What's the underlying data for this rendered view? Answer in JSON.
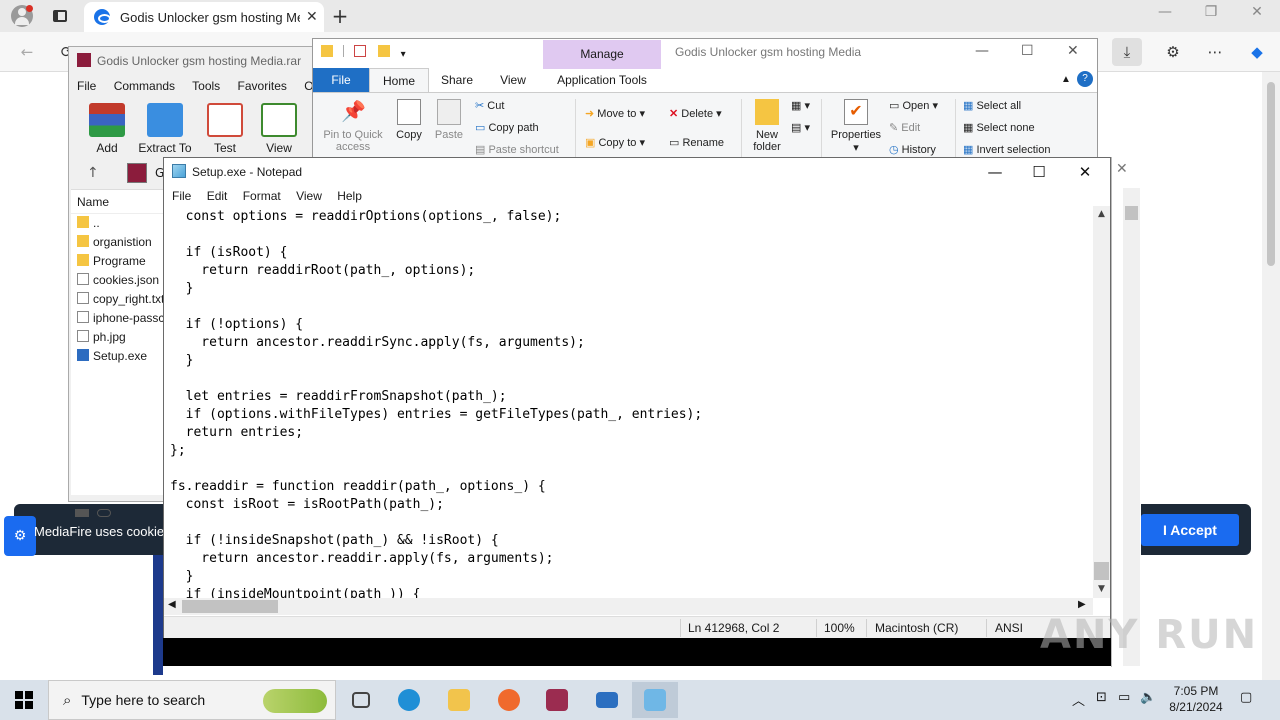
{
  "browser": {
    "tab_title": "Godis Unlocker gsm hosting Media",
    "tab_close": "✕",
    "new_tab": "+",
    "controls": {
      "minimize": "—",
      "maximize": "❐",
      "close": "✕"
    }
  },
  "page": {
    "cookie_text": "MediaFire uses cookies",
    "accept_label": "I Accept"
  },
  "winrar": {
    "title": "Godis Unlocker gsm hosting Media.rar",
    "menu": [
      "File",
      "Commands",
      "Tools",
      "Favorites",
      "Optio"
    ],
    "tools": [
      {
        "label": "Add",
        "color": "#c23a2b"
      },
      {
        "label": "Extract To",
        "color": "#3a8ee0"
      },
      {
        "label": "Test",
        "color": "#d04a3a"
      },
      {
        "label": "View",
        "color": "#3d8a2e"
      }
    ],
    "path_label": "Go",
    "column_name": "Name",
    "files": [
      {
        "name": "..",
        "kind": "folder"
      },
      {
        "name": "organistion",
        "kind": "folder"
      },
      {
        "name": "Programe",
        "kind": "folder"
      },
      {
        "name": "cookies.json",
        "kind": "file"
      },
      {
        "name": "copy_right.txt",
        "kind": "file"
      },
      {
        "name": "iphone-passc",
        "kind": "file"
      },
      {
        "name": "ph.jpg",
        "kind": "file"
      },
      {
        "name": "Setup.exe",
        "kind": "exe"
      }
    ]
  },
  "explorer": {
    "manage_label": "Manage",
    "title": "Godis Unlocker gsm hosting Media",
    "tabs": {
      "file": "File",
      "home": "Home",
      "share": "Share",
      "view": "View",
      "app_tools": "Application Tools"
    },
    "ribbon": {
      "pin_to_quick": "Pin to Quick",
      "access": "access",
      "copy": "Copy",
      "paste": "Paste",
      "cut": "Cut",
      "copy_path": "Copy path",
      "paste_shortcut": "Paste shortcut",
      "move_to": "Move to",
      "copy_to": "Copy to",
      "delete": "Delete",
      "rename": "Rename",
      "new": "New",
      "folder": "folder",
      "properties": "Properties",
      "open": "Open",
      "edit": "Edit",
      "history": "History",
      "select_all": "Select all",
      "select_none": "Select none",
      "invert_selection": "Invert selection"
    }
  },
  "notepad": {
    "title": "Setup.exe - Notepad",
    "menu": [
      "File",
      "Edit",
      "Format",
      "View",
      "Help"
    ],
    "code": "  const options = readdirOptions(options_, false);\n\n  if (isRoot) {\n    return readdirRoot(path_, options);\n  }\n\n  if (!options) {\n    return ancestor.readdirSync.apply(fs, arguments);\n  }\n\n  let entries = readdirFromSnapshot(path_);\n  if (options.withFileTypes) entries = getFileTypes(path_, entries);\n  return entries;\n};\n\nfs.readdir = function readdir(path_, options_) {\n  const isRoot = isRootPath(path_);\n\n  if (!insideSnapshot(path_) && !isRoot) {\n    return ancestor.readdir.apply(fs, arguments);\n  }\n  if (insideMountpoint(path_)) {",
    "status": {
      "position": "Ln 412968, Col 2",
      "zoom": "100%",
      "line_ending": "Macintosh (CR)",
      "encoding": "ANSI"
    }
  },
  "watermark": "ANY RUN",
  "taskbar": {
    "search_placeholder": "Type here to search",
    "time": "7:05 PM",
    "date": "8/21/2024",
    "apps": [
      {
        "name": "task-view",
        "color": "#444444"
      },
      {
        "name": "edge",
        "color": "#1f8fd6"
      },
      {
        "name": "file-explorer",
        "color": "#f2c44c"
      },
      {
        "name": "firefox",
        "color": "#f06a2d"
      },
      {
        "name": "winrar",
        "color": "#9b2c50"
      },
      {
        "name": "mediafire-app",
        "color": "#2c6fc0"
      },
      {
        "name": "notepad",
        "color": "#6fb7e6"
      }
    ]
  }
}
